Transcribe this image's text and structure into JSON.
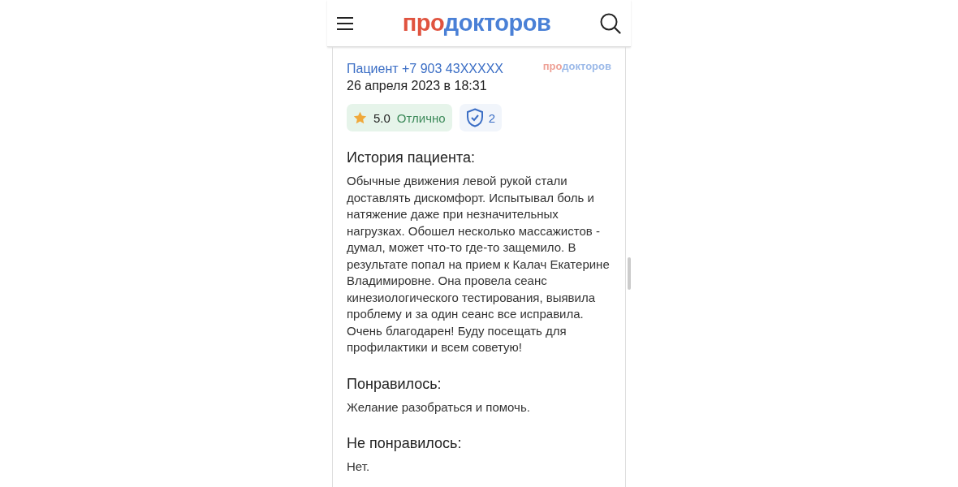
{
  "header": {
    "logo": {
      "first": "про",
      "second": "докторов"
    }
  },
  "review": {
    "author": "Пациент +7 903 43XXXXX",
    "date": "26 апреля 2023 в 18:31",
    "source_logo": {
      "first": "про",
      "second": "докторов"
    },
    "rating": {
      "value": "5.0",
      "label": "Отлично"
    },
    "verified_count": "2",
    "sections": [
      {
        "title": "История пациента:",
        "text": "Обычные движения левой рукой стали доставлять дискомфорт. Испытывал боль и натяжение даже при незначительных нагрузках. Обошел несколько массажистов - думал, может что-то где-то защемило. В результате попал на прием к Калач Екатерине Владимировне. Она провела сеанс кинезиологического тестирования, выявила проблему и за один сеанс все исправила. Очень благодарен! Буду посещать для профилактики и всем советую!"
      },
      {
        "title": "Понравилось:",
        "text": "Желание разобраться и помочь."
      },
      {
        "title": "Не понравилось:",
        "text": "Нет."
      }
    ]
  }
}
